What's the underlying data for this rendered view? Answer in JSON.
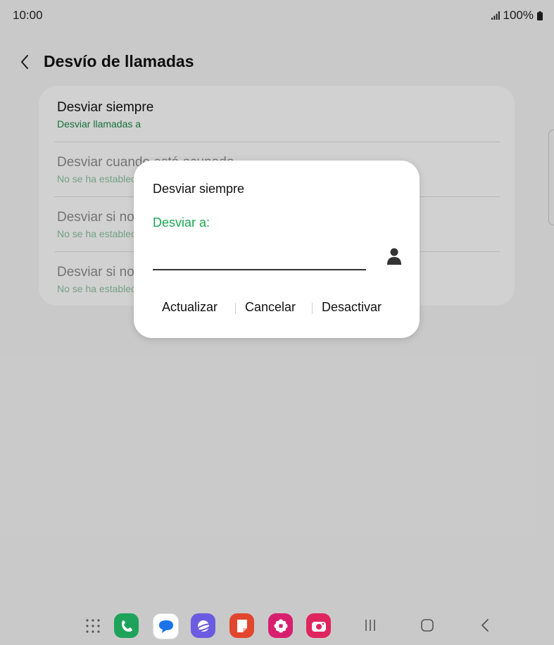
{
  "status": {
    "time": "10:00",
    "battery_text": "100%"
  },
  "header": {
    "title": "Desvío de llamadas"
  },
  "rows": [
    {
      "title": "Desviar siempre",
      "subtitle": "Desviar llamadas a"
    },
    {
      "title": "Desviar cuando está ocupado",
      "subtitle": "No se ha establecido"
    },
    {
      "title": "Desviar si no responde",
      "subtitle": "No se ha establecido"
    },
    {
      "title": "Desviar si no disponible",
      "subtitle": "No se ha establecido"
    }
  ],
  "dialog": {
    "title": "Desviar siempre",
    "label": "Desviar a:",
    "input_value": "",
    "actions": {
      "update": "Actualizar",
      "cancel": "Cancelar",
      "deactivate": "Desactivar"
    }
  },
  "dock": {
    "apps": [
      {
        "name": "apps-drawer-icon"
      },
      {
        "name": "phone-app-icon",
        "color": "#1fa35b"
      },
      {
        "name": "messages-app-icon",
        "color": "#ffffff"
      },
      {
        "name": "internet-app-icon",
        "color": "#6b5be0"
      },
      {
        "name": "notes-app-icon",
        "color": "#e2462e"
      },
      {
        "name": "gallery-app-icon",
        "color": "#d81f6e"
      },
      {
        "name": "camera-app-icon",
        "color": "#e0245e"
      }
    ]
  },
  "colors": {
    "accent_green": "#1aa654",
    "background": "#f6f6f6"
  }
}
